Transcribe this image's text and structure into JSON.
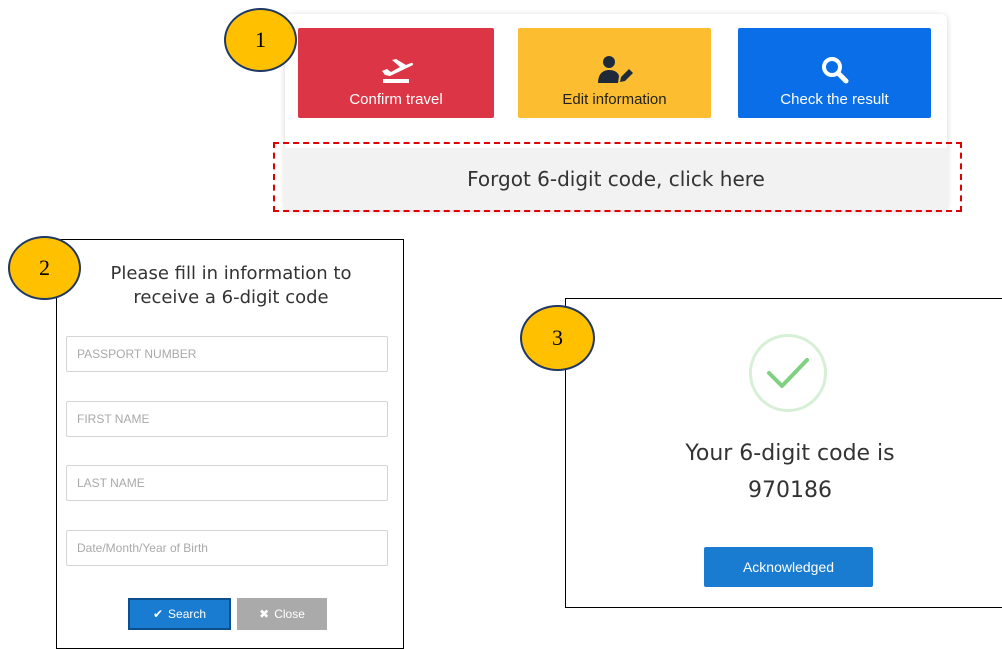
{
  "steps": {
    "one": "1",
    "two": "2",
    "three": "3"
  },
  "panel1": {
    "tiles": [
      {
        "label": "Confirm travel",
        "icon": "airplane-takeoff-icon",
        "color": "#dc3545"
      },
      {
        "label": "Edit information",
        "icon": "user-edit-icon",
        "color": "#fdbd30"
      },
      {
        "label": "Check the result",
        "icon": "search-icon",
        "color": "#0a6ee8"
      }
    ],
    "forgot_link": "Forgot 6-digit code, click here"
  },
  "panel2": {
    "title_line1": "Please fill in information to",
    "title_line2": "receive a 6-digit code",
    "fields": {
      "passport": {
        "placeholder": "PASSPORT NUMBER",
        "value": ""
      },
      "first_name": {
        "placeholder": "FIRST NAME",
        "value": ""
      },
      "last_name": {
        "placeholder": "LAST NAME",
        "value": ""
      },
      "dob": {
        "placeholder": "Date/Month/Year of Birth",
        "value": ""
      }
    },
    "search_label": "Search",
    "close_label": "Close"
  },
  "panel3": {
    "title": "Your 6-digit code is",
    "code": "970186",
    "ack_label": "Acknowledged"
  },
  "colors": {
    "badge": "#ffc000",
    "accent_blue": "#1a7cd0",
    "dashed_highlight": "#e00000",
    "success_check": "#7fd07f"
  }
}
